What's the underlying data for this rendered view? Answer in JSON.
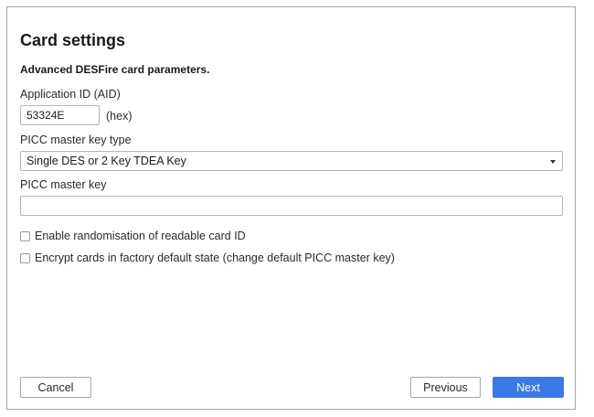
{
  "header": {
    "title": "Card settings",
    "subtitle": "Advanced DESFire card parameters."
  },
  "aid": {
    "label": "Application ID (AID)",
    "value": "53324E",
    "suffix": "(hex)"
  },
  "key_type": {
    "label": "PICC master key type",
    "selected": "Single DES or 2 Key TDEA Key"
  },
  "master_key": {
    "label": "PICC master key",
    "value": ""
  },
  "options": {
    "randomise_label": "Enable randomisation of readable card ID",
    "randomise_checked": false,
    "encrypt_label": "Encrypt cards in factory default state (change default PICC master key)",
    "encrypt_checked": false
  },
  "footer": {
    "cancel_label": "Cancel",
    "previous_label": "Previous",
    "next_label": "Next"
  },
  "colors": {
    "primary": "#3c79e8",
    "border": "#a8a8a8"
  }
}
